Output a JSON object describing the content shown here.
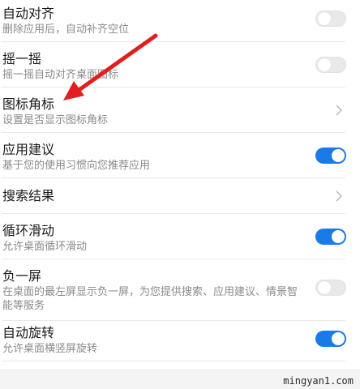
{
  "settings": {
    "items": [
      {
        "title": "自动对齐",
        "subtitle": "删除应用后，自动补齐空位",
        "control": "switch",
        "state": "off"
      },
      {
        "title": "摇一摇",
        "subtitle": "摇一摇自动对齐桌面图标",
        "control": "switch",
        "state": "off"
      },
      {
        "title": "图标角标",
        "subtitle": "设置是否显示图标角标",
        "control": "chevron"
      },
      {
        "title": "应用建议",
        "subtitle": "基于您的使用习惯向您推荐应用",
        "control": "switch",
        "state": "on"
      },
      {
        "title": "搜索结果",
        "control": "chevron"
      },
      {
        "title": "循环滑动",
        "subtitle": "允许桌面循环滑动",
        "control": "switch",
        "state": "on"
      },
      {
        "title": "负一屏",
        "subtitle": "在桌面的最左屏显示负一屏，为您提供搜索、应用建议、情景智能等服务",
        "control": "switch",
        "state": "off"
      },
      {
        "title": "自动旋转",
        "subtitle": "允许桌面横竖屏旋转",
        "control": "switch",
        "state": "on"
      }
    ]
  },
  "colors": {
    "switch_on": "#1a7ae8",
    "switch_off": "#e9e9e9",
    "annotation_arrow": "#e21f1f"
  },
  "icons": {
    "chevron": "chevron-right-icon",
    "annotation": "red-arrow-icon"
  },
  "watermark": {
    "text": "mingyan1.com"
  }
}
